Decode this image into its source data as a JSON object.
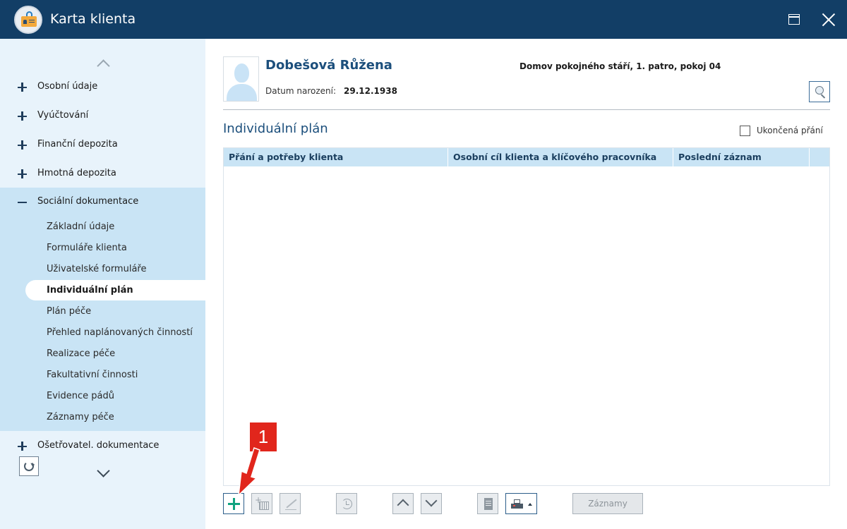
{
  "window": {
    "title": "Karta klienta"
  },
  "sidebar": {
    "sections": [
      {
        "label": "Osobní údaje"
      },
      {
        "label": "Vyúčtování"
      },
      {
        "label": "Finanční depozita"
      },
      {
        "label": "Hmotná depozita"
      },
      {
        "label": "Sociální dokumentace"
      },
      {
        "label": "Ošetřovatel. dokumentace"
      }
    ],
    "subitems": [
      {
        "label": "Základní údaje"
      },
      {
        "label": "Formuláře klienta"
      },
      {
        "label": "Uživatelské formuláře"
      },
      {
        "label": "Individuální plán"
      },
      {
        "label": "Plán péče"
      },
      {
        "label": "Přehled naplánovaných činností"
      },
      {
        "label": "Realizace péče"
      },
      {
        "label": "Fakultativní činnosti"
      },
      {
        "label": "Evidence pádů"
      },
      {
        "label": "Záznamy péče"
      }
    ]
  },
  "client": {
    "name": "Dobešová Růžena",
    "dob_label": "Datum narození:",
    "dob": "29.12.1938",
    "location": "Domov pokojného stáří, 1. patro, pokoj 04"
  },
  "section": {
    "title": "Individuální plán",
    "checkbox_label": "Ukončená přání",
    "checkbox_checked": false
  },
  "table": {
    "columns": [
      "Přání a potřeby klienta",
      "Osobní cíl klienta a klíčového pracovníka",
      "Poslední záznam"
    ],
    "rows": []
  },
  "toolbar": {
    "records_label": "Záznamy"
  },
  "annotation": {
    "number": "1"
  },
  "colors": {
    "titlebar": "#123e66",
    "sidebar": "#e8f3fb",
    "sidebar_expanded": "#c9e4f5",
    "accent_text": "#1c4f7c",
    "annotation": "#e1261c",
    "add_icon": "#10a37f"
  }
}
